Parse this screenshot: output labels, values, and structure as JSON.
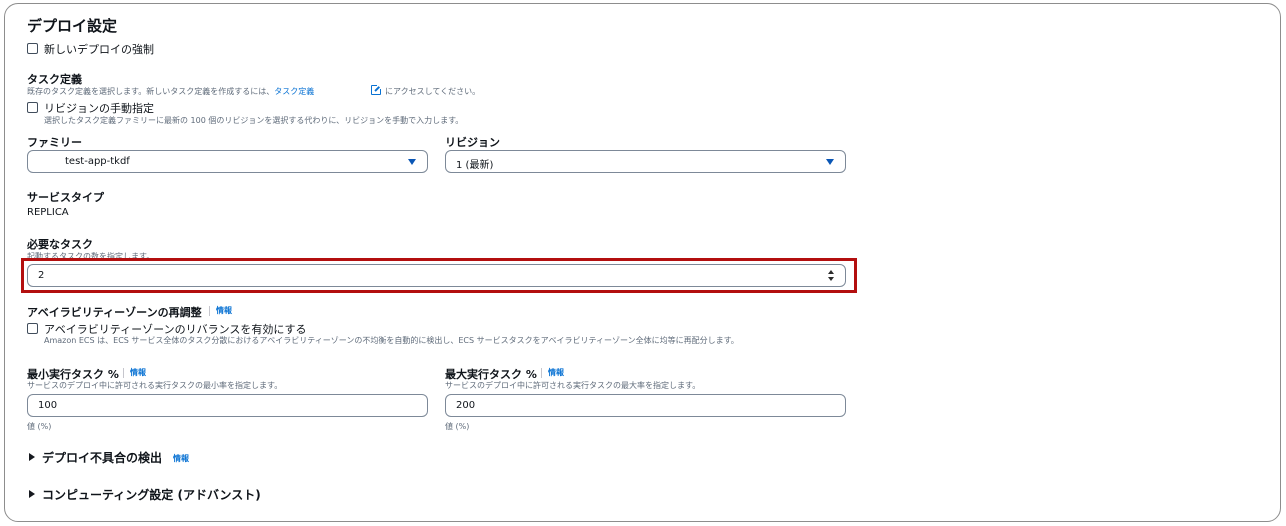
{
  "section_title": "デプロイ設定",
  "force_new_deploy": {
    "label": "新しいデプロイの強制",
    "checked": false
  },
  "task_definition": {
    "label": "タスク定義",
    "desc_prefix": "既存のタスク定義を選択します。新しいタスク定義を作成するには、",
    "desc_link": "タスク定義",
    "desc_suffix": "にアクセスしてください。",
    "manual_revision": {
      "label": "リビジョンの手動指定",
      "desc": "選択したタスク定義ファミリーに最新の 100 個のリビジョンを選択する代わりに、リビジョンを手動で入力します。",
      "checked": false
    },
    "family": {
      "label": "ファミリー",
      "value": "test-app-tkdf"
    },
    "revision": {
      "label": "リビジョン",
      "value": "1 (最新)"
    }
  },
  "service_type": {
    "label": "サービスタイプ",
    "value": "REPLICA"
  },
  "desired_tasks": {
    "label": "必要なタスク",
    "desc": "起動するタスクの数を指定します。",
    "value": "2"
  },
  "az_rebalance": {
    "label": "アベイラビリティーゾーンの再調整",
    "info": "情報",
    "checkbox_label": "アベイラビリティーゾーンのリバランスを有効にする",
    "checkbox_desc": "Amazon ECS は、ECS サービス全体のタスク分散におけるアベイラビリティーゾーンの不均衡を自動的に検出し、ECS サービスタスクをアベイラビリティーゾーン全体に均等に再配分します。",
    "checked": false
  },
  "min_percent": {
    "label": "最小実行タスク %",
    "info": "情報",
    "desc": "サービスのデプロイ中に許可される実行タスクの最小率を指定します。",
    "value": "100",
    "unit": "値 (%)"
  },
  "max_percent": {
    "label": "最大実行タスク %",
    "info": "情報",
    "desc": "サービスのデプロイ中に許可される実行タスクの最大率を指定します。",
    "value": "200",
    "unit": "値 (%)"
  },
  "deploy_failure": {
    "label": "デプロイ不具合の検出",
    "info": "情報"
  },
  "compute_settings": {
    "label": "コンピューティング設定 (アドバンスト)"
  },
  "colors": {
    "link": "#0972d3",
    "highlight": "#b30f0f",
    "border": "#7d8998"
  },
  "icons": {
    "caret": "caret-down-icon",
    "external": "external-link-icon",
    "expand": "expand-triangle-icon",
    "spinner": "number-spinner-icon"
  }
}
